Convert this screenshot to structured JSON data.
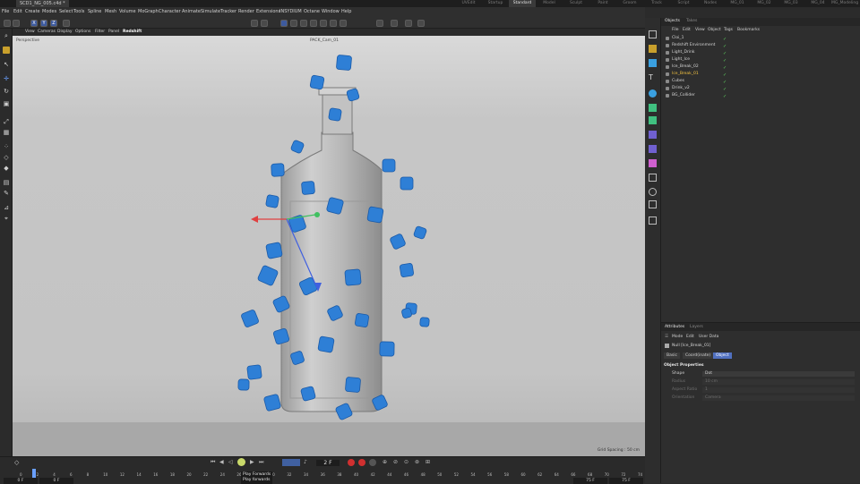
{
  "tabs": {
    "file": "SCD1_NG_005.c4d *",
    "layouts": [
      "UVEdit",
      "Startup",
      "Standard",
      "Model",
      "Sculpt",
      "Paint",
      "Groom",
      "Track",
      "Script",
      "Nodes",
      "MG_01",
      "MG_02",
      "MG_03",
      "MG_04",
      "MG_Modeling"
    ],
    "active_layout": "Standard"
  },
  "menu": [
    "File",
    "Edit",
    "Create",
    "Modes",
    "Select",
    "Tools",
    "Spline",
    "Mesh",
    "Volume",
    "MoGraph",
    "Character",
    "Animate",
    "Simulate",
    "Tracker",
    "Render",
    "Extensions",
    "INSYDIUM",
    "Octane",
    "Window",
    "Help"
  ],
  "toolbar": {
    "xyz": [
      "X",
      "Y",
      "Z"
    ]
  },
  "viewport_menu": [
    "View",
    "Cameras",
    "Display",
    "Options",
    "Filter",
    "Panel",
    "Redshift"
  ],
  "viewport": {
    "label": "Perspective",
    "camera": "PACK_Cam_01",
    "grid_spacing": "Grid Spacing : 50 cm"
  },
  "timeline": {
    "ticks": [
      "0",
      "2",
      "4",
      "6",
      "8",
      "10",
      "12",
      "14",
      "16",
      "18",
      "20",
      "22",
      "24",
      "26",
      "28",
      "30",
      "32",
      "34",
      "36",
      "38",
      "40",
      "42",
      "44",
      "46",
      "48",
      "50",
      "52",
      "54",
      "56",
      "58",
      "60",
      "62",
      "64",
      "66",
      "68",
      "70",
      "72",
      "74"
    ],
    "start": "0 F",
    "start2": "0 F",
    "current": "2 F",
    "end": "75 F",
    "end2": "75 F",
    "tooltip_title": "Play Forwards",
    "tooltip_desc": "Play forwards"
  },
  "objects_panel": {
    "tabs": [
      "Objects",
      "Takes"
    ],
    "menu": [
      "File",
      "Edit",
      "View",
      "Object",
      "Tags",
      "Bookmarks"
    ],
    "items": [
      {
        "name": "Cloi_1",
        "highlight": false
      },
      {
        "name": "Redshift Environment",
        "highlight": false
      },
      {
        "name": "Light_Drink",
        "highlight": false
      },
      {
        "name": "Light_Ice",
        "highlight": false
      },
      {
        "name": "Ice_Break_02",
        "highlight": false
      },
      {
        "name": "Ice_Break_01",
        "highlight": true
      },
      {
        "name": "Cubes",
        "highlight": false
      },
      {
        "name": "Drink_v2",
        "highlight": false
      },
      {
        "name": "BG_Collider",
        "highlight": false
      }
    ]
  },
  "attributes": {
    "tabs": [
      "Attributes",
      "Layers"
    ],
    "menu": [
      "Mode",
      "Edit",
      "User Data"
    ],
    "object_name": "Null [Ice_Break_01]",
    "sub_tabs": [
      "Basic",
      "Coord(inate)",
      "Object"
    ],
    "active_sub_tab": "Object",
    "section": "Object Properties",
    "props": [
      {
        "label": "Shape",
        "value": "Dot",
        "dim": false
      },
      {
        "label": "Radius",
        "value": "10 cm",
        "dim": true
      },
      {
        "label": "Aspect Ratio",
        "value": "1",
        "dim": true
      },
      {
        "label": "Orientation",
        "value": "Camera",
        "dim": true
      }
    ]
  },
  "colors": {
    "cube_blue": "#2e7fd6",
    "accent": "#5070c0",
    "highlight": "#f0c040"
  }
}
